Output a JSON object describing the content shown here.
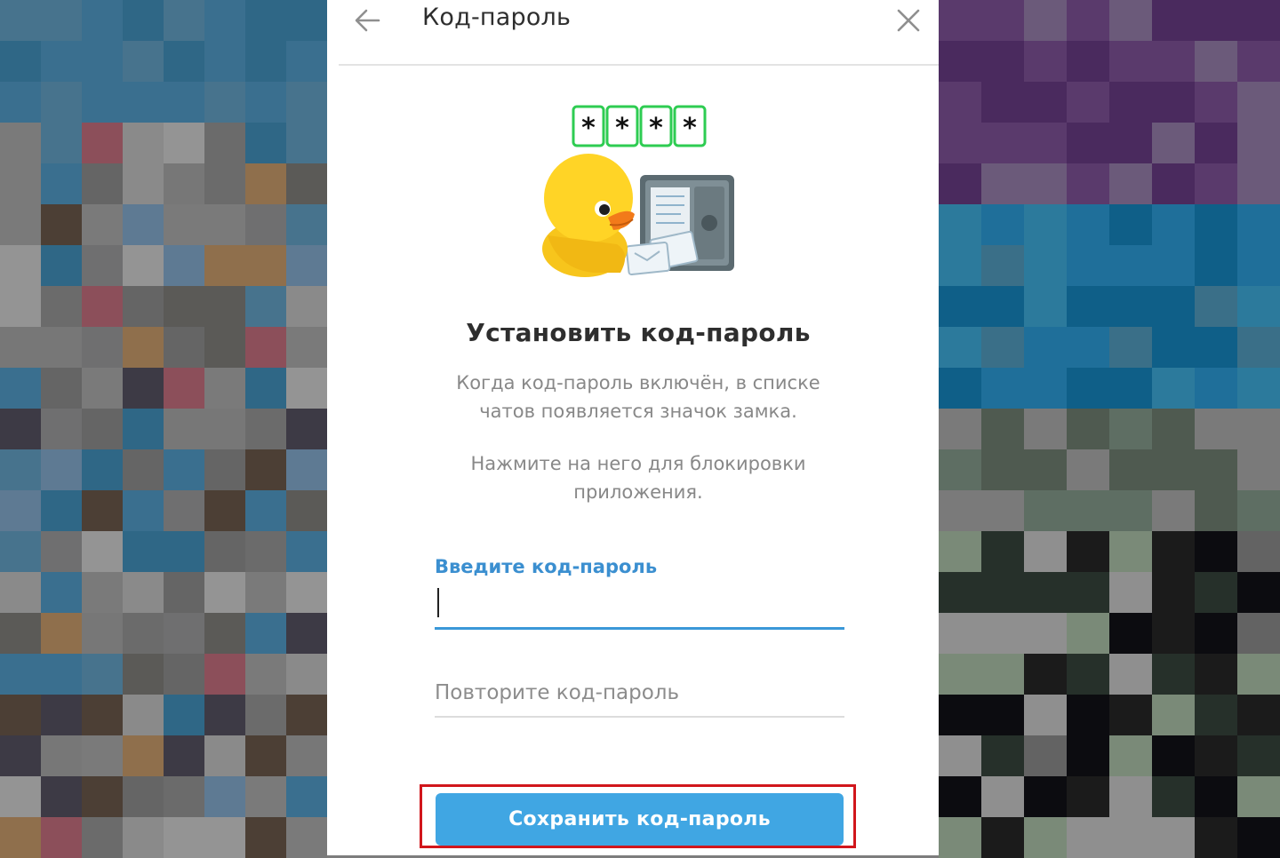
{
  "dialog": {
    "title": "Код-пароль",
    "back_icon": "arrow-left-icon",
    "close_icon": "close-icon"
  },
  "illustration": {
    "pin_masks": [
      "*",
      "*",
      "*",
      "*"
    ],
    "description": "duck-with-safe-sticker"
  },
  "content": {
    "heading": "Установить код-пароль",
    "description_1": "Когда код-пароль включён, в списке чатов появляется значок замка.",
    "description_2": "Нажмите на него для блокировки приложения."
  },
  "form": {
    "passcode_label": "Введите код-пароль",
    "passcode_value": "",
    "repeat_placeholder": "Повторите код-пароль",
    "save_label": "Сохранить код-пароль"
  },
  "colors": {
    "accent": "#40a6e3",
    "label": "#3b8fd0",
    "highlight": "#d1161c",
    "pin_border": "#2ecc52"
  }
}
